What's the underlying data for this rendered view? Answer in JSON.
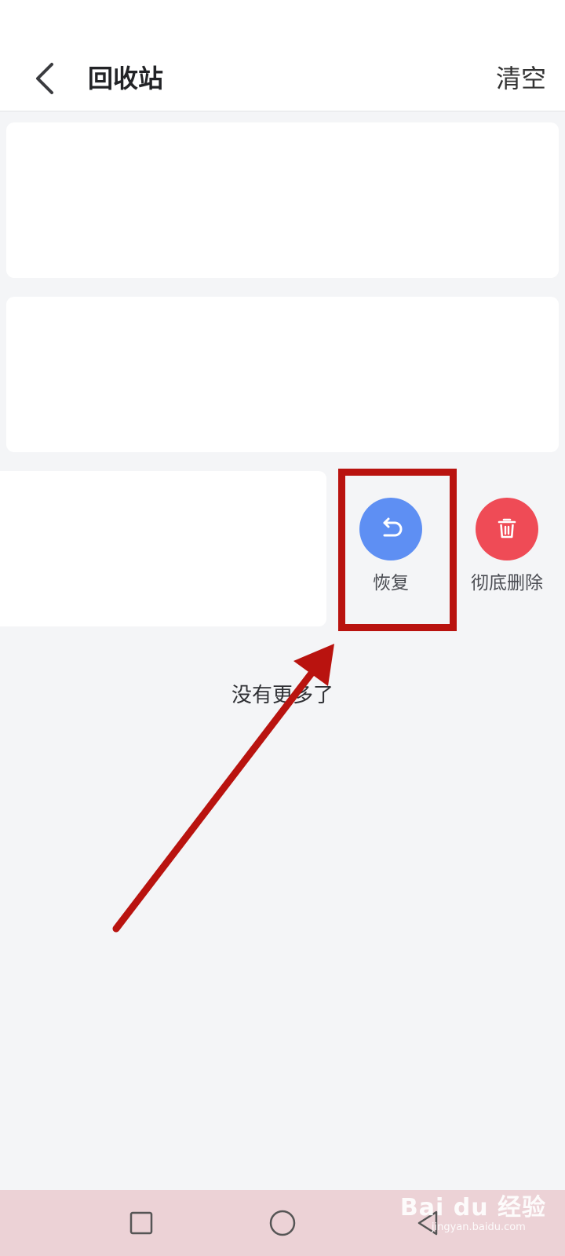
{
  "header": {
    "title": "回收站",
    "clear_label": "清空"
  },
  "actions": {
    "restore_label": "恢复",
    "delete_label": "彻底删除"
  },
  "footer": {
    "end_text": "没有更多了"
  },
  "colors": {
    "restore": "#5e8ff3",
    "delete": "#ef4b56",
    "annotation": "#b9130f"
  },
  "watermark": {
    "brand": "Bai du 经验",
    "url": "jingyan.baidu.com"
  }
}
